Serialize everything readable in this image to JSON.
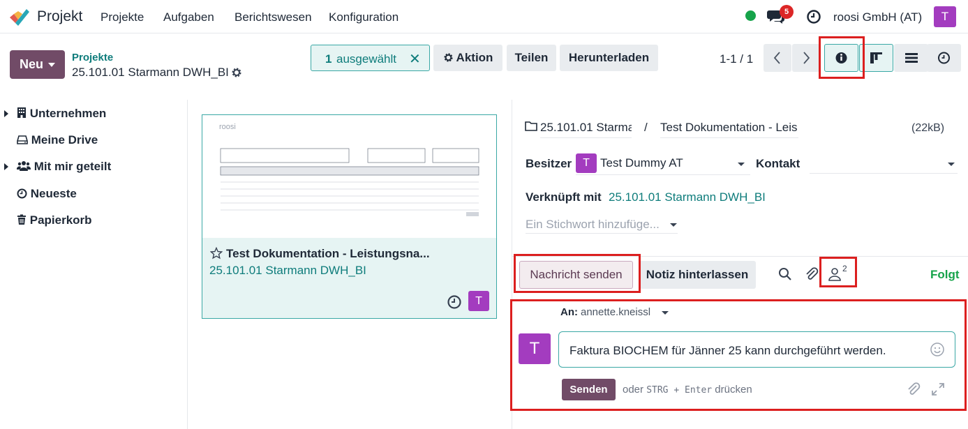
{
  "navbar": {
    "app_name": "Projekt",
    "menu": [
      "Projekte",
      "Aufgaben",
      "Berichtswesen",
      "Konfiguration"
    ],
    "chat_count": "5",
    "company": "roosi GmbH (AT)",
    "user_initial": "T",
    "status_color": "#16a34a"
  },
  "control": {
    "new_label": "Neu",
    "breadcrumb_parent": "Projekte",
    "breadcrumb_current": "25.101.01 Starmann DWH_BI",
    "selected_count": "1",
    "selected_label": "ausgewählt",
    "action_label": "Aktion",
    "share_label": "Teilen",
    "download_label": "Herunterladen",
    "pager": "1-1 / 1"
  },
  "sidebar": {
    "items": [
      "Unternehmen",
      "Meine Drive",
      "Mit mir geteilt",
      "Neueste",
      "Papierkorb"
    ]
  },
  "card": {
    "thumb_logo": "roosi",
    "title": "Test Dokumentation - Leistungsna...",
    "subtitle": "25.101.01 Starmann DWH_BI",
    "avatar": "T"
  },
  "details": {
    "folder": "25.101.01 Starma",
    "document": "Test Dokumentation - Leis",
    "size": "(22kB)",
    "owner_label": "Besitzer",
    "owner_initial": "T",
    "owner_name": "Test Dummy AT",
    "contact_label": "Kontakt",
    "linked_label": "Verknüpft mit",
    "linked_value": "25.101.01 Starmann DWH_BI",
    "tag_placeholder": "Ein Stichwort hinzufüge..."
  },
  "chatter": {
    "send_message": "Nachricht senden",
    "log_note": "Notiz hinterlassen",
    "followers_count": "2",
    "following": "Folgt",
    "to_label": "An:",
    "to_value": "annette.kneissl",
    "user_initial": "T",
    "message": "Faktura BIOCHEM für Jänner 25 kann durchgeführt werden.",
    "send_button": "Senden",
    "hint_prefix": "oder",
    "hint_keys": "STRG + Enter",
    "hint_suffix": "drücken"
  },
  "colors": {
    "brand": "#714b67",
    "accent": "#0e7c7b",
    "highlight": "#dc1f1f",
    "avatar": "#a33cbf"
  }
}
